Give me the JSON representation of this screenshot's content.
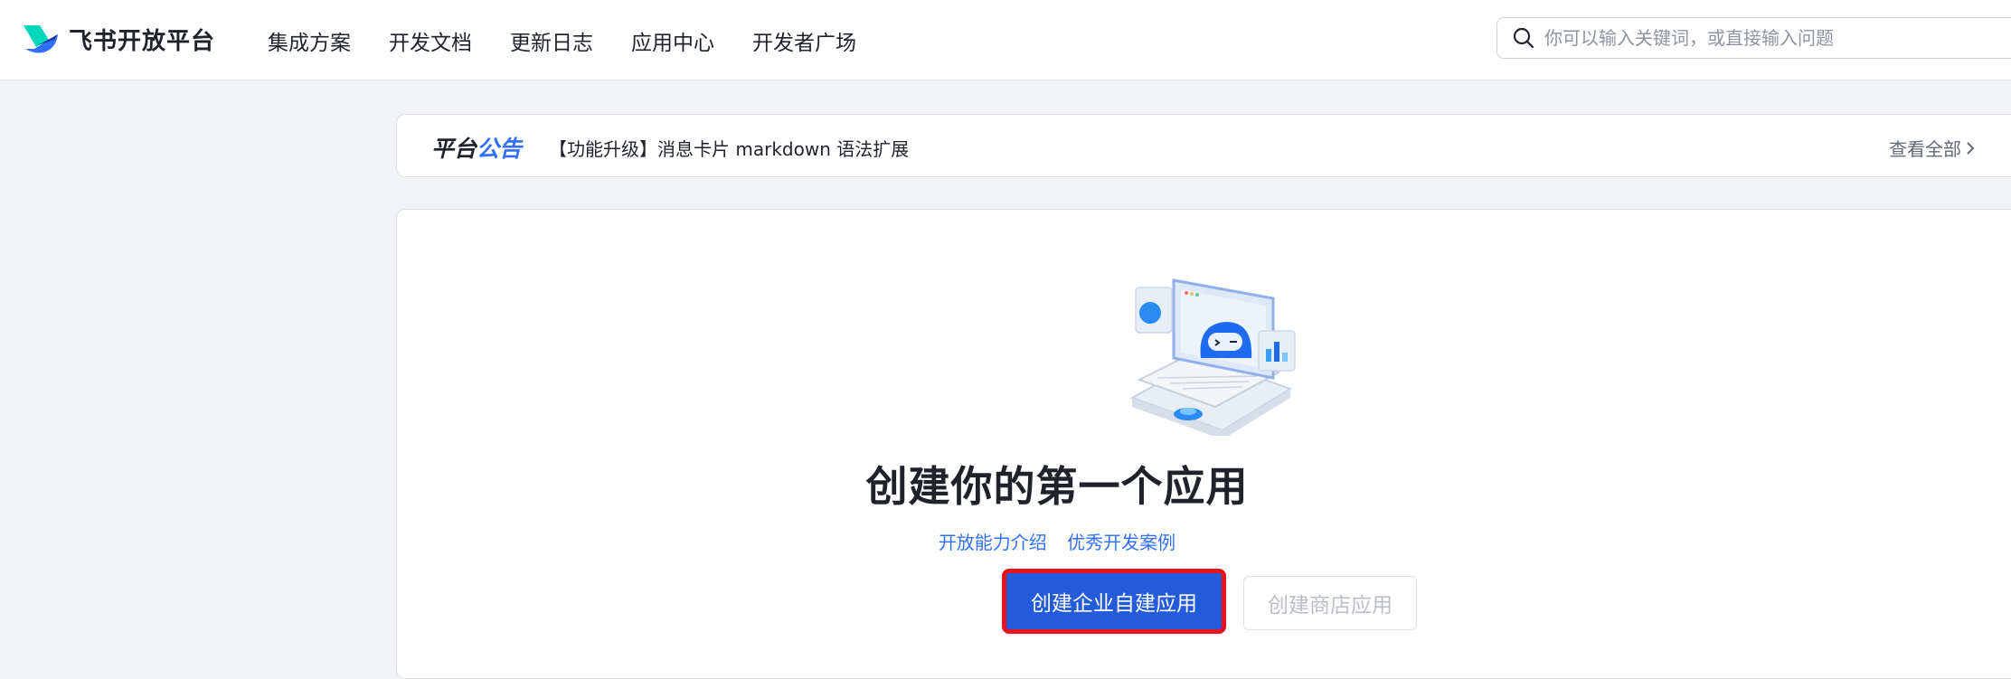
{
  "brand": {
    "name": "飞书开放平台"
  },
  "nav": {
    "items": [
      {
        "label": "集成方案"
      },
      {
        "label": "开发文档"
      },
      {
        "label": "更新日志"
      },
      {
        "label": "应用中心"
      },
      {
        "label": "开发者广场"
      }
    ]
  },
  "search": {
    "placeholder": "你可以输入关键词，或直接输入问题",
    "icon": "search-icon"
  },
  "announcement": {
    "title_part1": "平台",
    "title_part2": "公告",
    "text": "【功能升级】消息卡片 markdown 语法扩展",
    "more_label": "查看全部"
  },
  "empty_state": {
    "headline": "创建你的第一个应用",
    "links": [
      {
        "label": "开放能力介绍"
      },
      {
        "label": "优秀开发案例"
      }
    ],
    "primary_button": "创建企业自建应用",
    "secondary_button": "创建商店应用"
  },
  "colors": {
    "accent": "#3370ff",
    "primary_button": "#245bdb",
    "highlight_outline": "#e8141b",
    "background": "#f2f3f5"
  }
}
